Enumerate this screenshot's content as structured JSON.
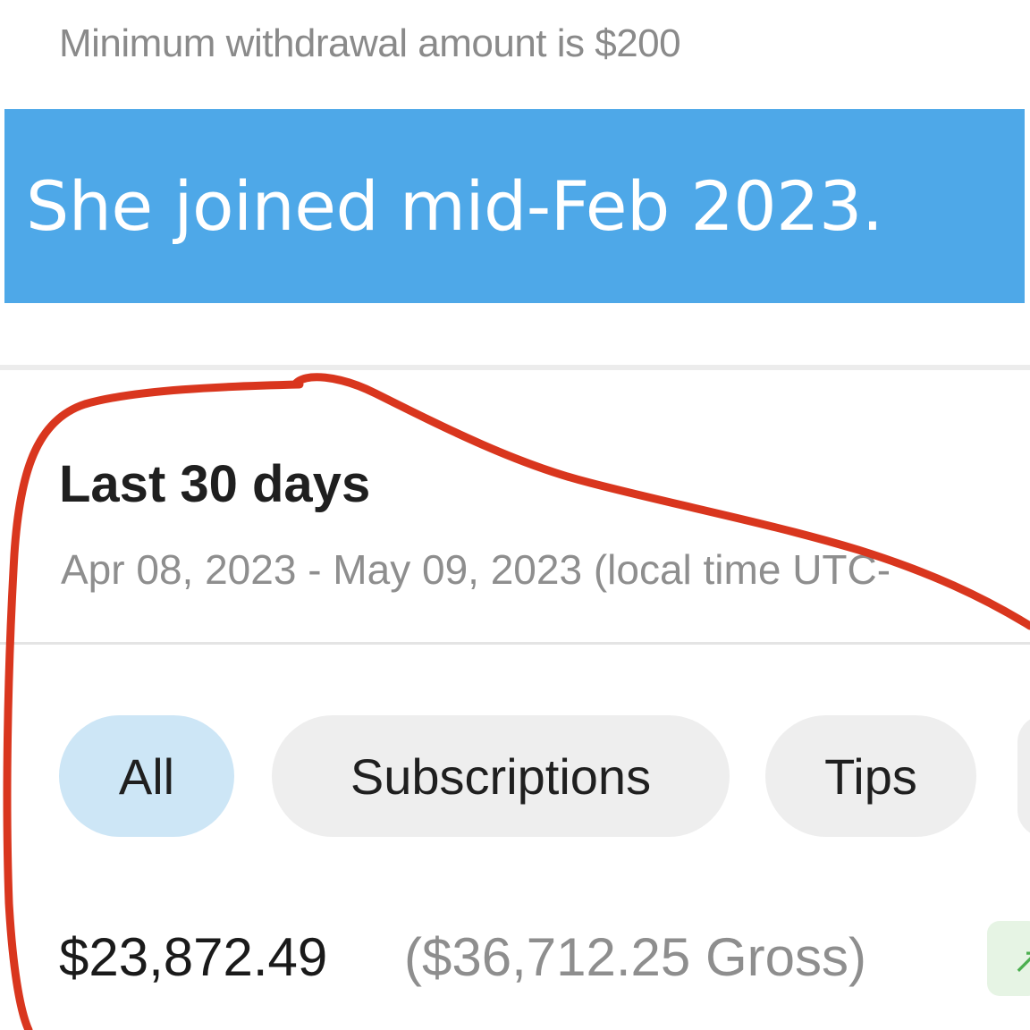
{
  "withdrawal": {
    "minimum_text": "Minimum withdrawal amount is $200"
  },
  "caption": {
    "text": "She joined mid-Feb 2023."
  },
  "earnings": {
    "period_title": "Last 30 days",
    "date_range": "Apr 08, 2023 - May 09, 2023 (local time UTC-",
    "filters": [
      {
        "label": "All",
        "selected": true
      },
      {
        "label": "Subscriptions",
        "selected": false
      },
      {
        "label": "Tips",
        "selected": false
      }
    ],
    "net_total": "$23,872.49",
    "gross_total": "($36,712.25 Gross)",
    "trend_icon": "trend-up-icon"
  },
  "colors": {
    "caption_background": "#4ea8e8",
    "selected_chip": "#cde6f6",
    "chip": "#eeeeee",
    "annotation_stroke": "#d9361e",
    "trend_green": "#4caf50"
  }
}
